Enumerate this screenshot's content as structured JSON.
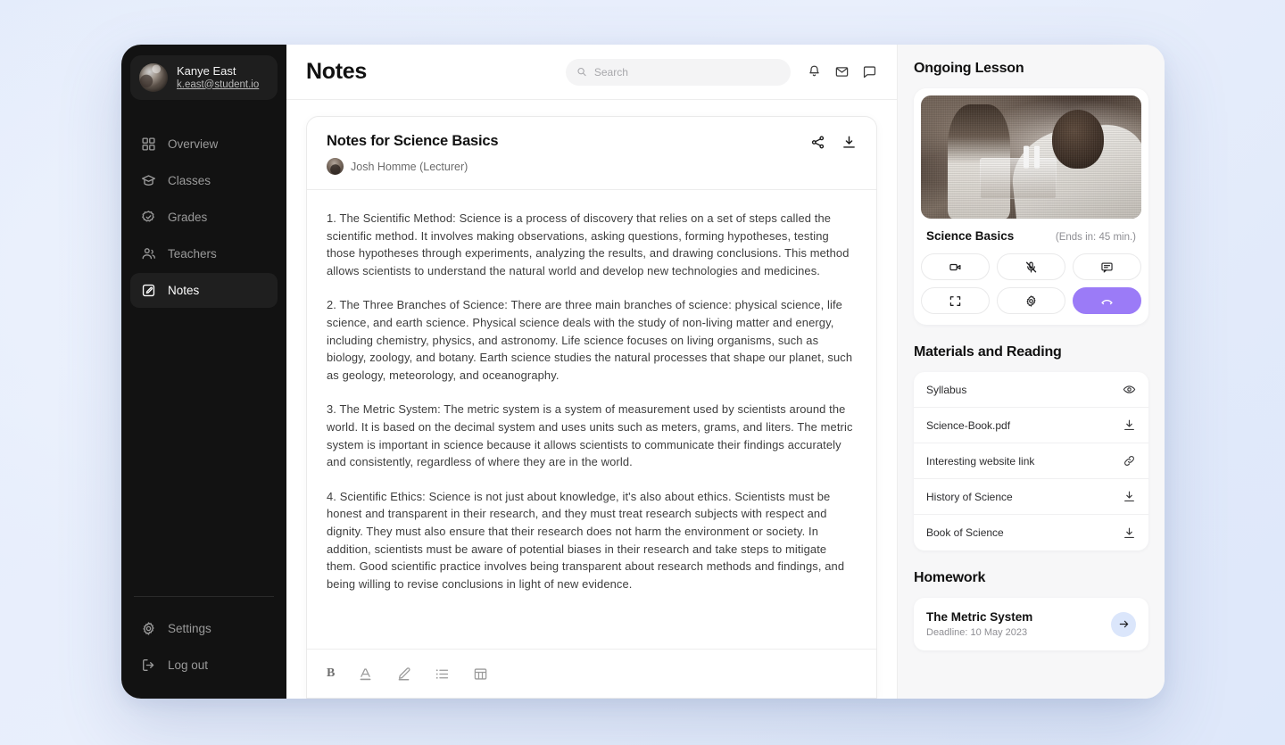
{
  "sidebar": {
    "profile": {
      "name": "Kanye East",
      "email": "k.east@student.io"
    },
    "items": [
      {
        "label": "Overview",
        "icon": "grid-icon",
        "active": false
      },
      {
        "label": "Classes",
        "icon": "graduation-cap-icon",
        "active": false
      },
      {
        "label": "Grades",
        "icon": "badge-check-icon",
        "active": false
      },
      {
        "label": "Teachers",
        "icon": "users-icon",
        "active": false
      },
      {
        "label": "Notes",
        "icon": "note-edit-icon",
        "active": true
      }
    ],
    "bottom_items": [
      {
        "label": "Settings",
        "icon": "gear-icon"
      },
      {
        "label": "Log out",
        "icon": "logout-icon"
      }
    ]
  },
  "topbar": {
    "title": "Notes",
    "search_placeholder": "Search",
    "search_value": "",
    "icons": [
      "bell-icon",
      "envelope-icon",
      "chat-bubble-icon"
    ]
  },
  "notes": {
    "title": "Notes for Science Basics",
    "author": "Josh Homme (Lecturer)",
    "actions": [
      "share-icon",
      "download-icon"
    ],
    "paragraphs": [
      "1. The Scientific Method: Science is a process of discovery that relies on a set of steps called the scientific method. It involves making observations, asking questions, forming hypotheses, testing those hypotheses through experiments, analyzing the results, and drawing conclusions. This method allows scientists to understand the natural world and develop new technologies and medicines.",
      "2. The Three Branches of Science: There are three main branches of science: physical science, life science, and earth science. Physical science deals with the study of non-living matter and energy, including chemistry, physics, and astronomy. Life science focuses on living organisms, such as biology, zoology, and botany. Earth science studies the natural processes that shape our planet, such as geology, meteorology, and oceanography.",
      "3. The Metric System: The metric system is a system of measurement used by scientists around the world. It is based on the decimal system and uses units such as meters, grams, and liters. The metric system is important in science because it allows scientists to communicate their findings accurately and consistently, regardless of where they are in the world.",
      "4. Scientific Ethics: Science is not just about knowledge, it's also about ethics. Scientists must be honest and transparent in their research, and they must treat research subjects with respect and dignity. They must also ensure that their research does not harm the environment or society. In addition, scientists must be aware of potential biases in their research and take steps to mitigate them. Good scientific practice involves being transparent about research methods and findings, and being willing to revise conclusions in light of new evidence."
    ],
    "toolbar": [
      {
        "name": "bold-icon",
        "label": "B"
      },
      {
        "name": "text-color-icon",
        "label": ""
      },
      {
        "name": "highlighter-pen-icon",
        "label": ""
      },
      {
        "name": "bullet-list-icon",
        "label": ""
      },
      {
        "name": "table-icon",
        "label": ""
      }
    ]
  },
  "right_panel": {
    "ongoing_lesson": {
      "heading": "Ongoing Lesson",
      "lesson_name": "Science Basics",
      "ends_in": "(Ends in: 45 min.)",
      "player_state": "pause-icon",
      "controls": [
        {
          "name": "video-camera-icon",
          "variant": "default"
        },
        {
          "name": "microphone-muted-icon",
          "variant": "default"
        },
        {
          "name": "chat-icon",
          "variant": "default"
        },
        {
          "name": "fullscreen-icon",
          "variant": "default"
        },
        {
          "name": "gear-icon",
          "variant": "default"
        },
        {
          "name": "end-call-icon",
          "variant": "accent"
        }
      ],
      "accent_color": "#9b7bf7"
    },
    "materials": {
      "heading": "Materials and Reading",
      "rows": [
        {
          "label": "Syllabus",
          "icon": "eye-icon"
        },
        {
          "label": "Science-Book.pdf",
          "icon": "download-icon"
        },
        {
          "label": "Interesting website link",
          "icon": "link-icon"
        },
        {
          "label": "History of Science",
          "icon": "download-icon"
        },
        {
          "label": "Book of Science",
          "icon": "download-icon"
        }
      ]
    },
    "homework": {
      "heading": "Homework",
      "title": "The Metric System",
      "deadline": "Deadline: 10 May 2023",
      "action_icon": "arrow-right-icon"
    }
  }
}
